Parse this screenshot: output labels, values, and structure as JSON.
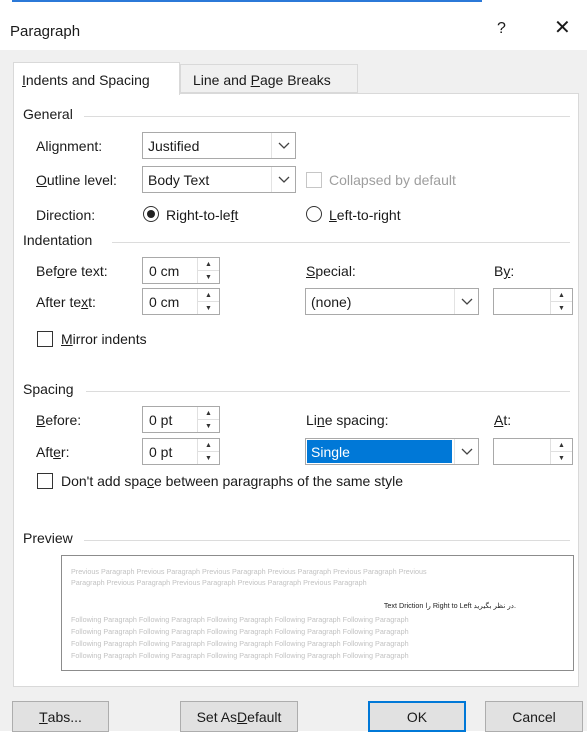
{
  "window": {
    "title": "Paragraph",
    "help": "?",
    "close": "✕"
  },
  "tabs": [
    {
      "pre": "",
      "mn": "I",
      "post": "ndents and Spacing"
    },
    {
      "pre": "Line and ",
      "mn": "P",
      "post": "age Breaks"
    }
  ],
  "general": {
    "title": "General",
    "alignment": {
      "pre": "Ali",
      "mn": "g",
      "post": "nment:",
      "value": "Justified"
    },
    "outline": {
      "pre": "",
      "mn": "O",
      "post": "utline level:",
      "value": "Body Text"
    },
    "collapsed_label": "Collapsed by default",
    "direction": {
      "label": "Direction:",
      "rtl": {
        "pre": "Right-to-le",
        "mn": "f",
        "post": "t"
      },
      "ltr": {
        "pre": "",
        "mn": "L",
        "post": "eft-to-right"
      }
    }
  },
  "indentation": {
    "title": "Indentation",
    "before": {
      "pre": "Bef",
      "mn": "o",
      "post": "re text:",
      "value": "0 cm"
    },
    "after": {
      "pre": "After te",
      "mn": "x",
      "post": "t:",
      "value": "0 cm"
    },
    "special": {
      "pre": "",
      "mn": "S",
      "post": "pecial:",
      "value": "(none)"
    },
    "by": {
      "pre": "B",
      "mn": "y",
      "post": ":",
      "value": ""
    },
    "mirror": {
      "pre": "",
      "mn": "M",
      "post": "irror indents"
    }
  },
  "spacing": {
    "title": "Spacing",
    "before": {
      "pre": "",
      "mn": "B",
      "post": "efore:",
      "value": "0 pt"
    },
    "after": {
      "pre": "Aft",
      "mn": "e",
      "post": "r:",
      "value": "0 pt"
    },
    "line": {
      "pre": "Li",
      "mn": "n",
      "post": "e spacing:",
      "value": "Single"
    },
    "at": {
      "pre": "",
      "mn": "A",
      "post": "t:",
      "value": ""
    },
    "dont_add": {
      "pre": "Don't add spa",
      "mn": "c",
      "post": "e between paragraphs of the same style"
    }
  },
  "preview": {
    "title": "Preview",
    "prev1": "Previous Paragraph Previous Paragraph Previous Paragraph Previous Paragraph Previous Paragraph Previous",
    "prev2": "Paragraph Previous Paragraph Previous Paragraph Previous Paragraph Previous Paragraph",
    "sample": "Text Driction را Right to Left در نظر بگیرید.",
    "follow": [
      "Following Paragraph Following Paragraph Following Paragraph Following Paragraph Following Paragraph",
      "Following Paragraph Following Paragraph Following Paragraph Following Paragraph Following Paragraph",
      "Following Paragraph Following Paragraph Following Paragraph Following Paragraph Following Paragraph",
      "Following Paragraph Following Paragraph Following Paragraph Following Paragraph Following Paragraph"
    ]
  },
  "buttons": {
    "tabs": {
      "pre": "",
      "mn": "T",
      "post": "abs..."
    },
    "set_default": {
      "pre": "Set As ",
      "mn": "D",
      "post": "efault"
    },
    "ok": "OK",
    "cancel": "Cancel"
  },
  "colors": {
    "accent": "#0078d7",
    "dialog_bg": "#f0f0f0",
    "panel_bg": "#ffffff"
  }
}
